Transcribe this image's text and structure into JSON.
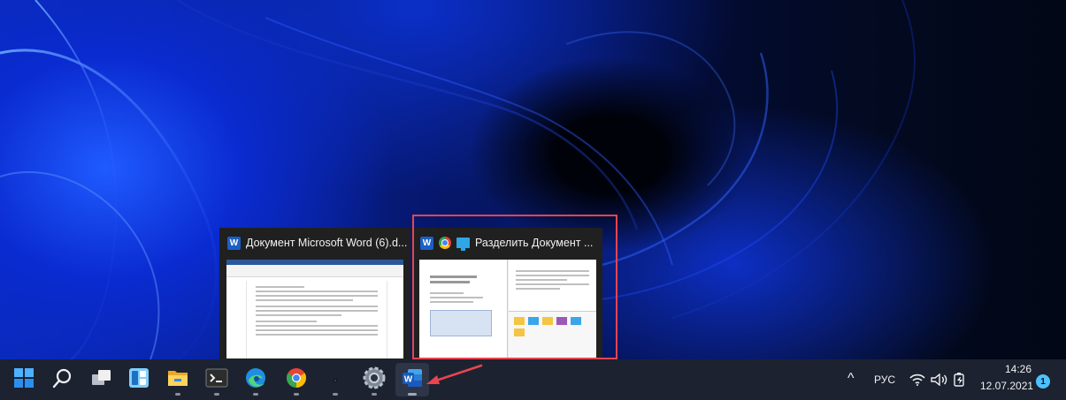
{
  "wallpaper": {
    "name": "Windows 11 bloom wallpaper"
  },
  "previews": [
    {
      "app_icon": "word-icon",
      "title": "Документ Microsoft Word (6).d..."
    },
    {
      "app_icons": [
        "word-icon",
        "chrome-icon",
        "monitor-icon"
      ],
      "title": "Разделить Документ ..."
    }
  ],
  "preview_doc": {
    "word_letter": "W"
  },
  "taskbar": {
    "icons": [
      "start-icon",
      "search-icon",
      "task-view-icon",
      "widgets-icon",
      "file-explorer-icon",
      "terminal-icon",
      "edge-icon",
      "chrome-icon",
      "app-icon",
      "settings-icon",
      "word-icon"
    ],
    "active": "word-icon"
  },
  "tray": {
    "chevron": "^",
    "language": "РУС",
    "time": "14:26",
    "date": "12.07.2021",
    "notifications": "1"
  },
  "colors": {
    "highlight": "#e8454f",
    "arrow": "#e8454f",
    "taskbar": "#1c2230",
    "accent": "#4cc2ff"
  }
}
